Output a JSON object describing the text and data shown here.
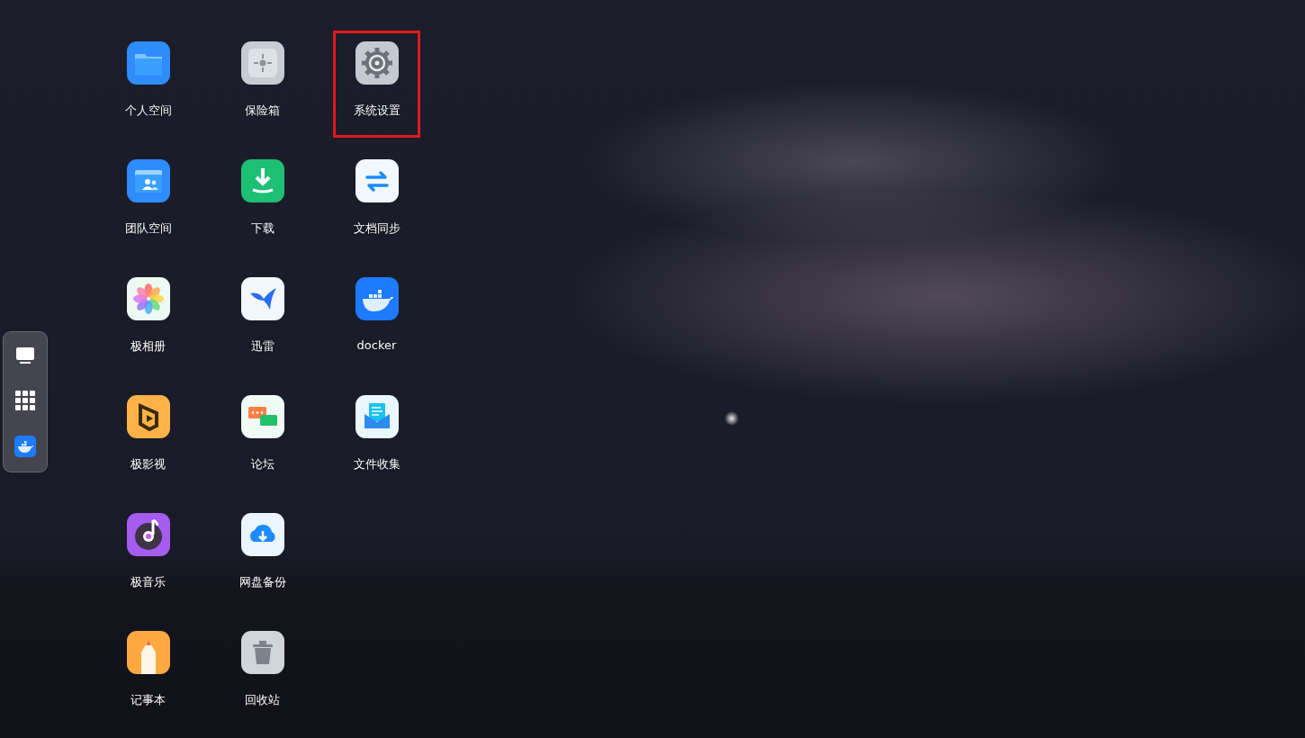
{
  "apps": [
    {
      "label": "个人空间",
      "kind": "folder",
      "highlighted": false
    },
    {
      "label": "团队空间",
      "kind": "team-folder",
      "highlighted": false
    },
    {
      "label": "极相册",
      "kind": "photos",
      "highlighted": false
    },
    {
      "label": "极影视",
      "kind": "video",
      "highlighted": false
    },
    {
      "label": "极音乐",
      "kind": "music",
      "highlighted": false
    },
    {
      "label": "记事本",
      "kind": "notepad",
      "highlighted": false
    },
    {
      "label": "保险箱",
      "kind": "safe",
      "highlighted": false
    },
    {
      "label": "下载",
      "kind": "download",
      "highlighted": false
    },
    {
      "label": "迅雷",
      "kind": "bird",
      "highlighted": false
    },
    {
      "label": "论坛",
      "kind": "chat",
      "highlighted": false
    },
    {
      "label": "网盘备份",
      "kind": "cloud",
      "highlighted": false
    },
    {
      "label": "回收站",
      "kind": "trash",
      "highlighted": false
    },
    {
      "label": "系统设置",
      "kind": "settings",
      "highlighted": true
    },
    {
      "label": "文档同步",
      "kind": "sync",
      "highlighted": false
    },
    {
      "label": "docker",
      "kind": "docker",
      "highlighted": false
    },
    {
      "label": "文件收集",
      "kind": "inbox",
      "highlighted": false
    }
  ],
  "dock": {
    "items": [
      {
        "kind": "monitor"
      },
      {
        "kind": "apps"
      },
      {
        "kind": "docker"
      }
    ]
  }
}
